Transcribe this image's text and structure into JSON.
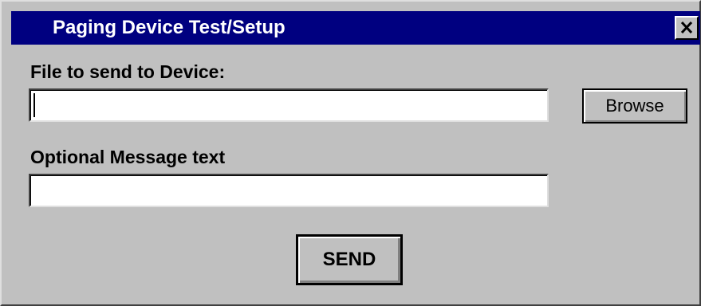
{
  "window": {
    "title": "Paging Device Test/Setup",
    "close_glyph": "close-icon"
  },
  "form": {
    "file_label": "File to send to Device:",
    "file_value": "",
    "browse_label": "Browse",
    "message_label": "Optional Message text",
    "message_value": "",
    "send_label": "SEND"
  },
  "colors": {
    "titlebar": "#000080",
    "face": "#c0c0c0",
    "field": "#ffffff"
  }
}
